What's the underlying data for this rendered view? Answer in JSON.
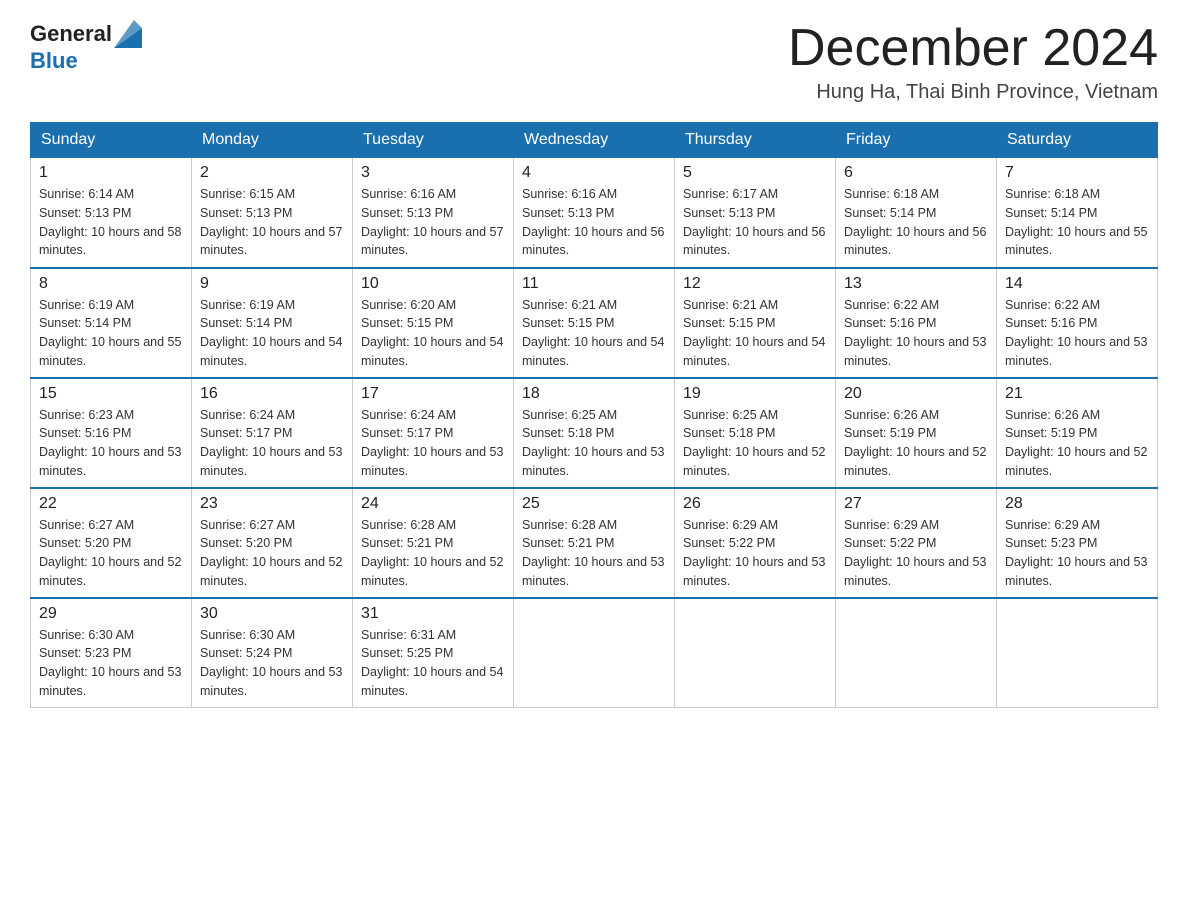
{
  "header": {
    "logo_general": "General",
    "logo_blue": "Blue",
    "month_title": "December 2024",
    "location": "Hung Ha, Thai Binh Province, Vietnam"
  },
  "weekdays": [
    "Sunday",
    "Monday",
    "Tuesday",
    "Wednesday",
    "Thursday",
    "Friday",
    "Saturday"
  ],
  "weeks": [
    [
      {
        "day": "1",
        "sunrise": "6:14 AM",
        "sunset": "5:13 PM",
        "daylight": "10 hours and 58 minutes."
      },
      {
        "day": "2",
        "sunrise": "6:15 AM",
        "sunset": "5:13 PM",
        "daylight": "10 hours and 57 minutes."
      },
      {
        "day": "3",
        "sunrise": "6:16 AM",
        "sunset": "5:13 PM",
        "daylight": "10 hours and 57 minutes."
      },
      {
        "day": "4",
        "sunrise": "6:16 AM",
        "sunset": "5:13 PM",
        "daylight": "10 hours and 56 minutes."
      },
      {
        "day": "5",
        "sunrise": "6:17 AM",
        "sunset": "5:13 PM",
        "daylight": "10 hours and 56 minutes."
      },
      {
        "day": "6",
        "sunrise": "6:18 AM",
        "sunset": "5:14 PM",
        "daylight": "10 hours and 56 minutes."
      },
      {
        "day": "7",
        "sunrise": "6:18 AM",
        "sunset": "5:14 PM",
        "daylight": "10 hours and 55 minutes."
      }
    ],
    [
      {
        "day": "8",
        "sunrise": "6:19 AM",
        "sunset": "5:14 PM",
        "daylight": "10 hours and 55 minutes."
      },
      {
        "day": "9",
        "sunrise": "6:19 AM",
        "sunset": "5:14 PM",
        "daylight": "10 hours and 54 minutes."
      },
      {
        "day": "10",
        "sunrise": "6:20 AM",
        "sunset": "5:15 PM",
        "daylight": "10 hours and 54 minutes."
      },
      {
        "day": "11",
        "sunrise": "6:21 AM",
        "sunset": "5:15 PM",
        "daylight": "10 hours and 54 minutes."
      },
      {
        "day": "12",
        "sunrise": "6:21 AM",
        "sunset": "5:15 PM",
        "daylight": "10 hours and 54 minutes."
      },
      {
        "day": "13",
        "sunrise": "6:22 AM",
        "sunset": "5:16 PM",
        "daylight": "10 hours and 53 minutes."
      },
      {
        "day": "14",
        "sunrise": "6:22 AM",
        "sunset": "5:16 PM",
        "daylight": "10 hours and 53 minutes."
      }
    ],
    [
      {
        "day": "15",
        "sunrise": "6:23 AM",
        "sunset": "5:16 PM",
        "daylight": "10 hours and 53 minutes."
      },
      {
        "day": "16",
        "sunrise": "6:24 AM",
        "sunset": "5:17 PM",
        "daylight": "10 hours and 53 minutes."
      },
      {
        "day": "17",
        "sunrise": "6:24 AM",
        "sunset": "5:17 PM",
        "daylight": "10 hours and 53 minutes."
      },
      {
        "day": "18",
        "sunrise": "6:25 AM",
        "sunset": "5:18 PM",
        "daylight": "10 hours and 53 minutes."
      },
      {
        "day": "19",
        "sunrise": "6:25 AM",
        "sunset": "5:18 PM",
        "daylight": "10 hours and 52 minutes."
      },
      {
        "day": "20",
        "sunrise": "6:26 AM",
        "sunset": "5:19 PM",
        "daylight": "10 hours and 52 minutes."
      },
      {
        "day": "21",
        "sunrise": "6:26 AM",
        "sunset": "5:19 PM",
        "daylight": "10 hours and 52 minutes."
      }
    ],
    [
      {
        "day": "22",
        "sunrise": "6:27 AM",
        "sunset": "5:20 PM",
        "daylight": "10 hours and 52 minutes."
      },
      {
        "day": "23",
        "sunrise": "6:27 AM",
        "sunset": "5:20 PM",
        "daylight": "10 hours and 52 minutes."
      },
      {
        "day": "24",
        "sunrise": "6:28 AM",
        "sunset": "5:21 PM",
        "daylight": "10 hours and 52 minutes."
      },
      {
        "day": "25",
        "sunrise": "6:28 AM",
        "sunset": "5:21 PM",
        "daylight": "10 hours and 53 minutes."
      },
      {
        "day": "26",
        "sunrise": "6:29 AM",
        "sunset": "5:22 PM",
        "daylight": "10 hours and 53 minutes."
      },
      {
        "day": "27",
        "sunrise": "6:29 AM",
        "sunset": "5:22 PM",
        "daylight": "10 hours and 53 minutes."
      },
      {
        "day": "28",
        "sunrise": "6:29 AM",
        "sunset": "5:23 PM",
        "daylight": "10 hours and 53 minutes."
      }
    ],
    [
      {
        "day": "29",
        "sunrise": "6:30 AM",
        "sunset": "5:23 PM",
        "daylight": "10 hours and 53 minutes."
      },
      {
        "day": "30",
        "sunrise": "6:30 AM",
        "sunset": "5:24 PM",
        "daylight": "10 hours and 53 minutes."
      },
      {
        "day": "31",
        "sunrise": "6:31 AM",
        "sunset": "5:25 PM",
        "daylight": "10 hours and 54 minutes."
      },
      null,
      null,
      null,
      null
    ]
  ]
}
